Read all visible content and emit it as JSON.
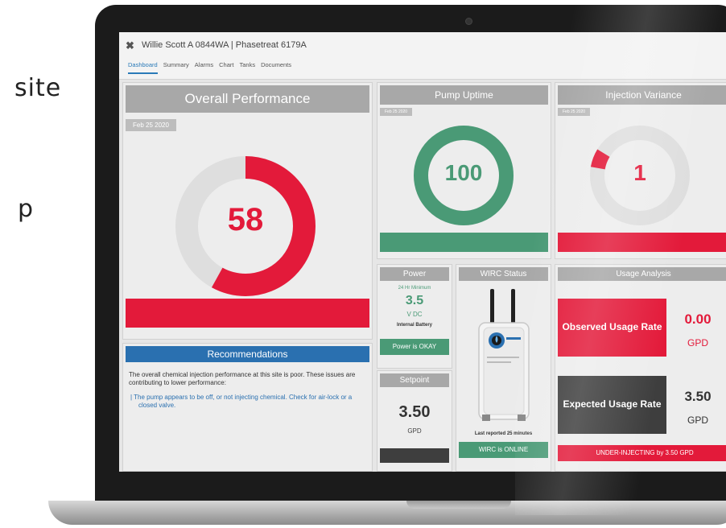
{
  "background": {
    "text_line1": "site",
    "text_line2": "p"
  },
  "app": {
    "title": "Willie Scott A 0844WA | Phasetreat 6179A",
    "close_icon": "close-icon",
    "tabs": [
      {
        "label": "Dashboard",
        "active": true
      },
      {
        "label": "Summary"
      },
      {
        "label": "Alarms"
      },
      {
        "label": "Chart"
      },
      {
        "label": "Tanks"
      },
      {
        "label": "Documents"
      }
    ]
  },
  "overall": {
    "title": "Overall Performance",
    "date": "Feb 25 2020",
    "value": "58",
    "value_fraction": 0.58,
    "color": "#e31a3a"
  },
  "recommendations": {
    "title": "Recommendations",
    "text": "The overall chemical injection performance at this site is poor. These issues are contributing to lower performance:",
    "item": "The pump appears to be off, or not injecting chemical. Check for air-lock or a closed valve."
  },
  "pump": {
    "title": "Pump Uptime",
    "date": "Feb 25 2020",
    "value": "100",
    "value_fraction": 1.0,
    "color": "#4a9a76"
  },
  "injection": {
    "title": "Injection Variance",
    "date": "Feb 25 2020",
    "value": "1",
    "value_fraction": 0.06,
    "color": "#e31a3a"
  },
  "power": {
    "title": "Power",
    "sub": "24 Hr Minimum",
    "value": "3.5",
    "unit": "V DC",
    "source": "Internal Battery",
    "status": "Power is OKAY"
  },
  "setpoint": {
    "title": "Setpoint",
    "value": "3.50",
    "unit": "GPD"
  },
  "wirc": {
    "title": "WIRC Status",
    "reported": "Last reported 25 minutes",
    "status": "WIRC is ONLINE"
  },
  "usage": {
    "title": "Usage Analysis",
    "observed_label": "Observed Usage Rate",
    "observed_value": "0.00",
    "observed_unit": "GPD",
    "expected_label": "Expected Usage Rate",
    "expected_value": "3.50",
    "expected_unit": "GPD",
    "alert": "UNDER-INJECTING by 3.50 GPD"
  },
  "colors": {
    "red": "#e31a3a",
    "green": "#4a9a76",
    "blue": "#2a70b0",
    "dark": "#3e3e3e",
    "gray": "#a8a8a8"
  }
}
